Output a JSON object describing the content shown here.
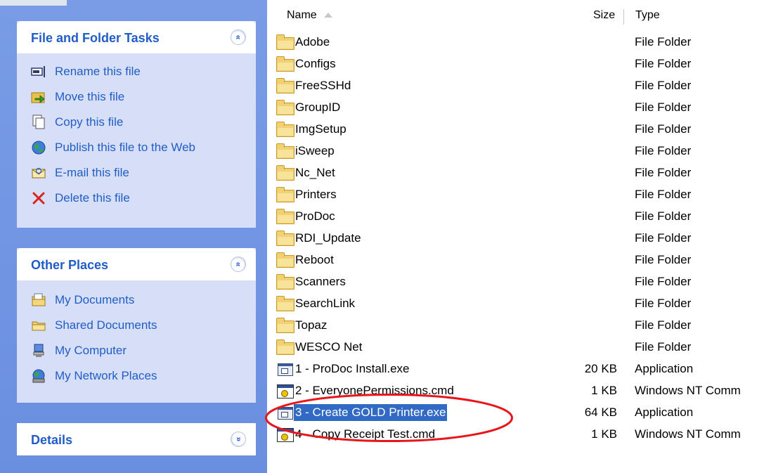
{
  "task_pane": {
    "file_folder_tasks": {
      "title": "File and Folder Tasks",
      "collapse_glyph": "»",
      "items": [
        {
          "label": "Rename this file",
          "icon": "rename-icon"
        },
        {
          "label": "Move this file",
          "icon": "move-icon"
        },
        {
          "label": "Copy this file",
          "icon": "copy-icon"
        },
        {
          "label": "Publish this file to the Web",
          "icon": "publish-web-icon"
        },
        {
          "label": "E-mail this file",
          "icon": "email-icon"
        },
        {
          "label": "Delete this file",
          "icon": "delete-icon"
        }
      ]
    },
    "other_places": {
      "title": "Other Places",
      "collapse_glyph": "»",
      "items": [
        {
          "label": "My Documents",
          "icon": "my-documents-icon"
        },
        {
          "label": "Shared Documents",
          "icon": "shared-documents-icon"
        },
        {
          "label": "My Computer",
          "icon": "my-computer-icon"
        },
        {
          "label": "My Network Places",
          "icon": "network-places-icon"
        }
      ]
    },
    "details": {
      "title": "Details",
      "expand_glyph": "»"
    }
  },
  "columns": {
    "name": "Name",
    "size": "Size",
    "type": "Type"
  },
  "files": [
    {
      "name": "Adobe",
      "size": "",
      "type": "File Folder",
      "icon": "folder-icon",
      "selected": false
    },
    {
      "name": "Configs",
      "size": "",
      "type": "File Folder",
      "icon": "folder-icon",
      "selected": false
    },
    {
      "name": "FreeSSHd",
      "size": "",
      "type": "File Folder",
      "icon": "folder-icon",
      "selected": false
    },
    {
      "name": "GroupID",
      "size": "",
      "type": "File Folder",
      "icon": "folder-icon",
      "selected": false
    },
    {
      "name": "ImgSetup",
      "size": "",
      "type": "File Folder",
      "icon": "folder-icon",
      "selected": false
    },
    {
      "name": "iSweep",
      "size": "",
      "type": "File Folder",
      "icon": "folder-icon",
      "selected": false
    },
    {
      "name": "Nc_Net",
      "size": "",
      "type": "File Folder",
      "icon": "folder-icon",
      "selected": false
    },
    {
      "name": "Printers",
      "size": "",
      "type": "File Folder",
      "icon": "folder-icon",
      "selected": false
    },
    {
      "name": "ProDoc",
      "size": "",
      "type": "File Folder",
      "icon": "folder-icon",
      "selected": false
    },
    {
      "name": "RDI_Update",
      "size": "",
      "type": "File Folder",
      "icon": "folder-icon",
      "selected": false
    },
    {
      "name": "Reboot",
      "size": "",
      "type": "File Folder",
      "icon": "folder-icon",
      "selected": false
    },
    {
      "name": "Scanners",
      "size": "",
      "type": "File Folder",
      "icon": "folder-icon",
      "selected": false
    },
    {
      "name": "SearchLink",
      "size": "",
      "type": "File Folder",
      "icon": "folder-icon",
      "selected": false
    },
    {
      "name": "Topaz",
      "size": "",
      "type": "File Folder",
      "icon": "folder-icon",
      "selected": false
    },
    {
      "name": "WESCO Net",
      "size": "",
      "type": "File Folder",
      "icon": "folder-icon",
      "selected": false
    },
    {
      "name": "1 - ProDoc Install.exe",
      "size": "20 KB",
      "type": "Application",
      "icon": "exe-icon",
      "selected": false
    },
    {
      "name": "2 - EveryonePermissions.cmd",
      "size": "1 KB",
      "type": "Windows NT Comm",
      "icon": "cmd-icon",
      "selected": false
    },
    {
      "name": "3 - Create GOLD Printer.exe",
      "size": "64 KB",
      "type": "Application",
      "icon": "exe-icon",
      "selected": true
    },
    {
      "name": "4 - Copy Receipt Test.cmd",
      "size": "1 KB",
      "type": "Windows NT Comm",
      "icon": "cmd-icon",
      "selected": false
    }
  ],
  "colors": {
    "pane_blue": "#6a8fe0",
    "link_blue": "#215dc6",
    "selection": "#316ac5",
    "annotation_red": "#e8161b"
  }
}
